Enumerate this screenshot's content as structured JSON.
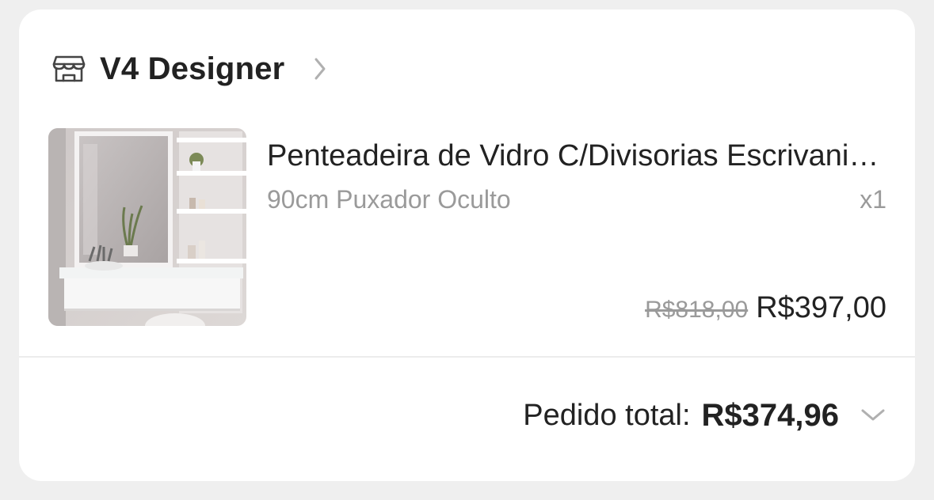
{
  "shop": {
    "name": "V4 Designer",
    "icon": "storefront-icon"
  },
  "product": {
    "title": "Penteadeira de Vidro C/Divisorias  Escrivaninha",
    "variant": "90cm Puxador Oculto",
    "quantity": "x1",
    "original_price": "R$818,00",
    "price": "R$397,00"
  },
  "order": {
    "total_label": "Pedido total:",
    "total_value": "R$374,96"
  },
  "colors": {
    "background": "#efefef",
    "card": "#ffffff",
    "text": "#222222",
    "muted": "#9a9a9a"
  }
}
